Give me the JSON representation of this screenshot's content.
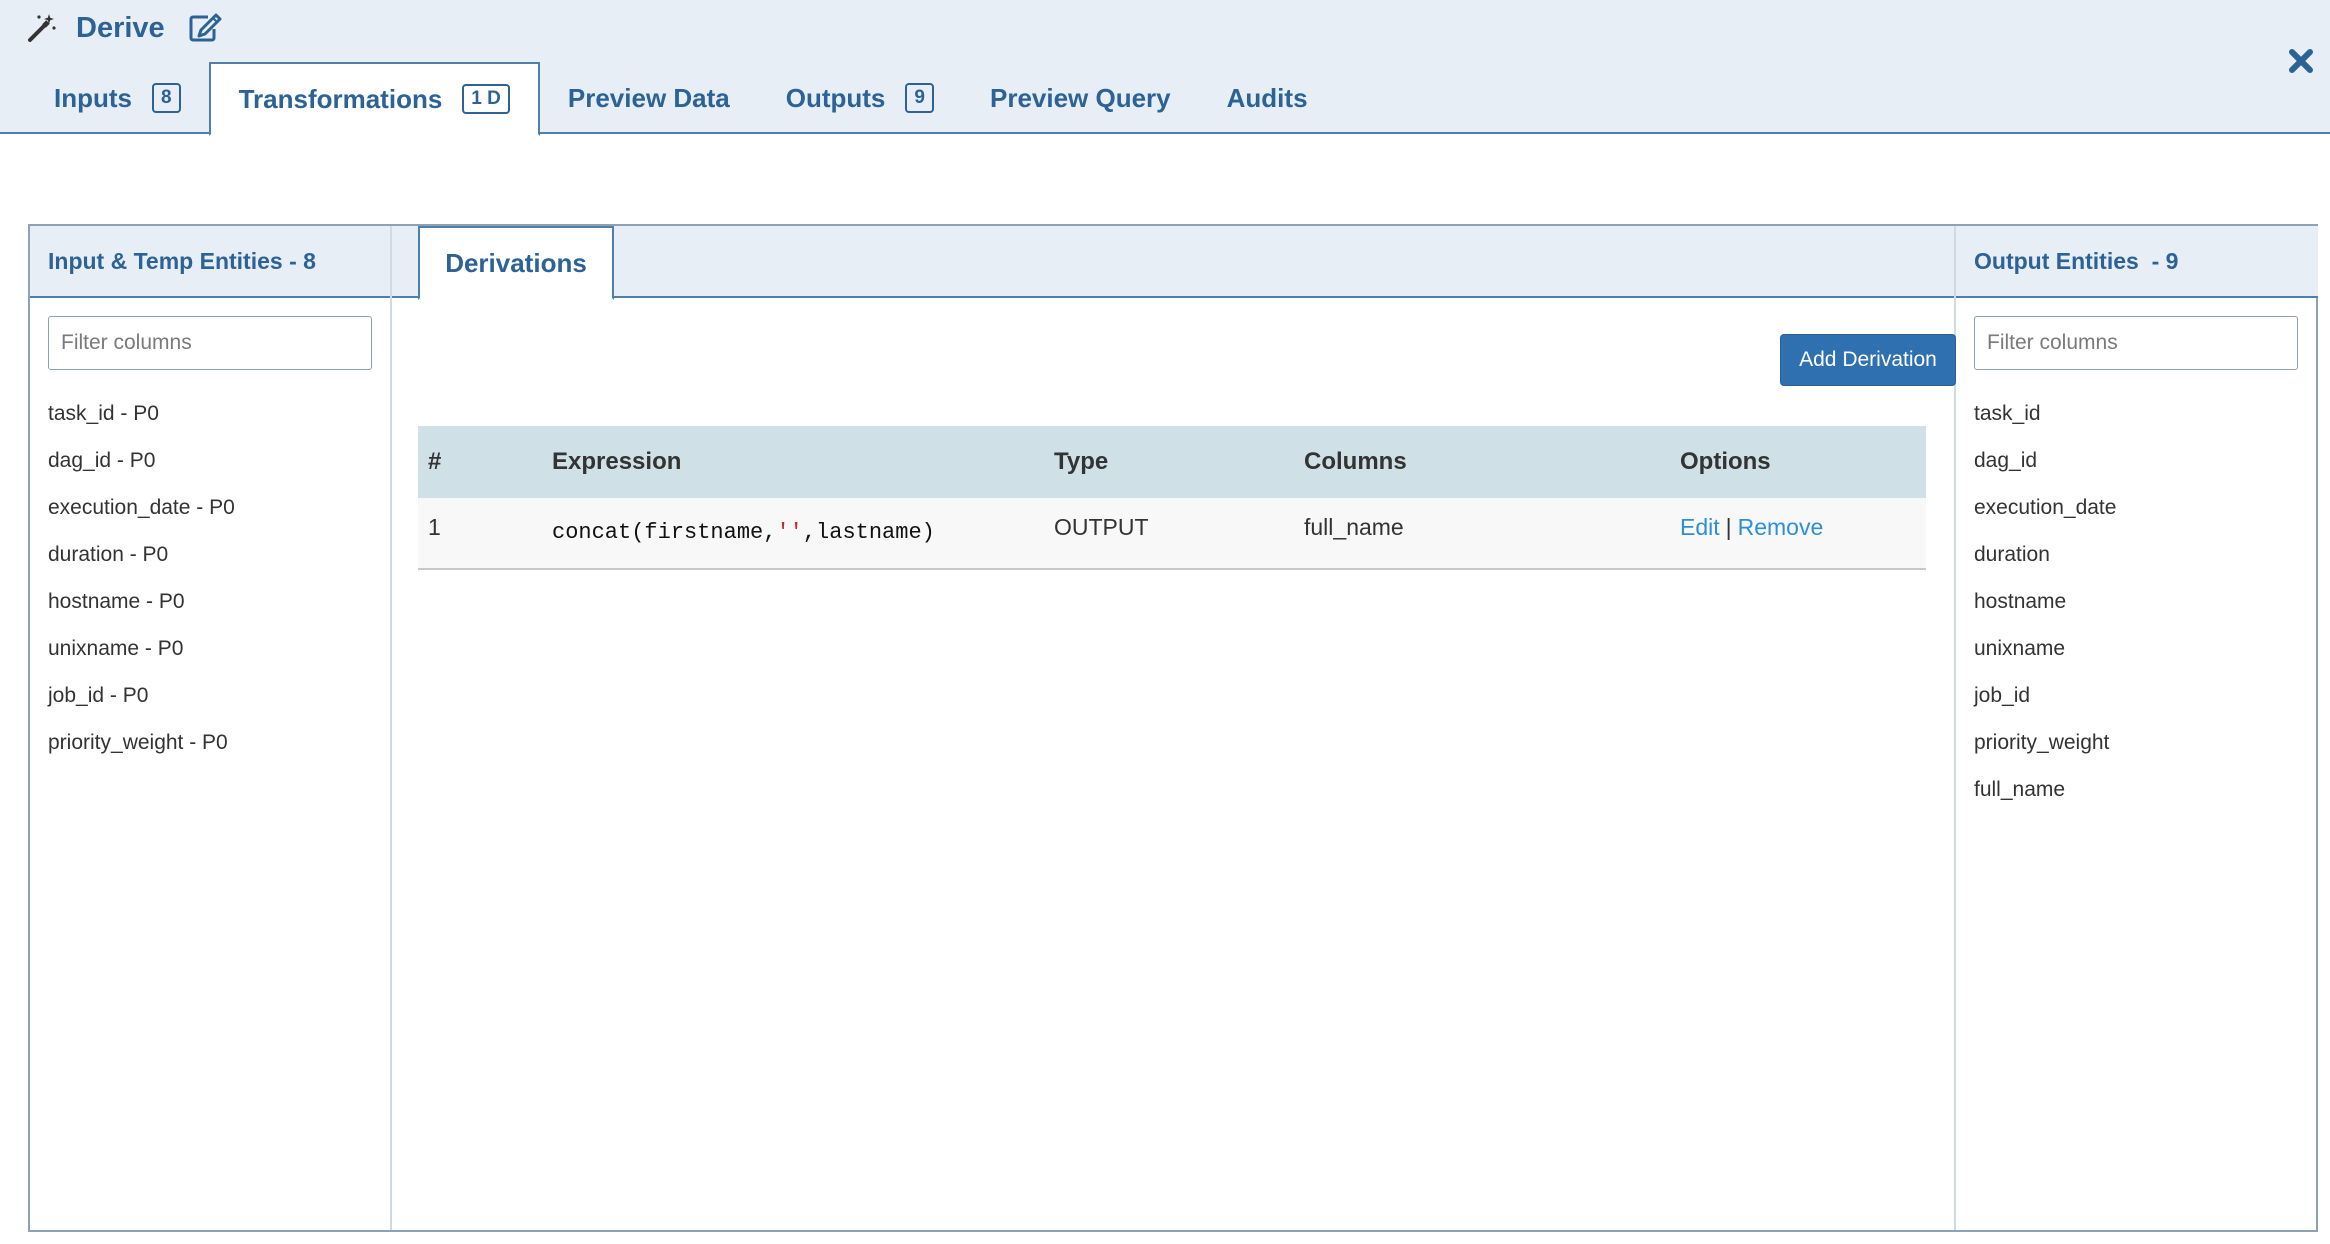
{
  "header": {
    "title": "Derive",
    "tabs": [
      {
        "label": "Inputs",
        "badge": "8"
      },
      {
        "label": "Transformations",
        "badge": "1 D"
      },
      {
        "label": "Preview Data"
      },
      {
        "label": "Outputs",
        "badge": "9"
      },
      {
        "label": "Preview Query"
      },
      {
        "label": "Audits"
      }
    ],
    "active_tab": "Transformations"
  },
  "left_panel": {
    "title": "Input & Temp Entities - 8",
    "filter_placeholder": "Filter columns",
    "items": [
      "task_id - P0",
      "dag_id - P0",
      "execution_date - P0",
      "duration - P0",
      "hostname - P0",
      "unixname - P0",
      "job_id - P0",
      "priority_weight - P0"
    ]
  },
  "middle_panel": {
    "tab_label": "Derivations",
    "add_button": "Add Derivation",
    "table": {
      "headers": [
        "#",
        "Expression",
        "Type",
        "Columns",
        "Options"
      ],
      "rows": [
        {
          "num": "1",
          "expr_pre": "concat(firstname,",
          "expr_str": "''",
          "expr_post": ",lastname)",
          "type": "OUTPUT",
          "columns": "full_name",
          "edit": "Edit",
          "separator": "|",
          "remove": "Remove"
        }
      ]
    }
  },
  "right_panel": {
    "title": "Output Entities  - 9",
    "filter_placeholder": "Filter columns",
    "items": [
      "task_id",
      "dag_id",
      "execution_date",
      "duration",
      "hostname",
      "unixname",
      "job_id",
      "priority_weight",
      "full_name"
    ]
  },
  "icons": {
    "title_icon": "magic-wand-icon",
    "edit_icon": "edit-icon",
    "close_icon": "close-icon"
  },
  "colors": {
    "header_bg": "#e8eef6",
    "accent": "#2c6296",
    "button": "#2f71b0",
    "link": "#2e8fd6",
    "table_header": "#cfe1e6"
  }
}
